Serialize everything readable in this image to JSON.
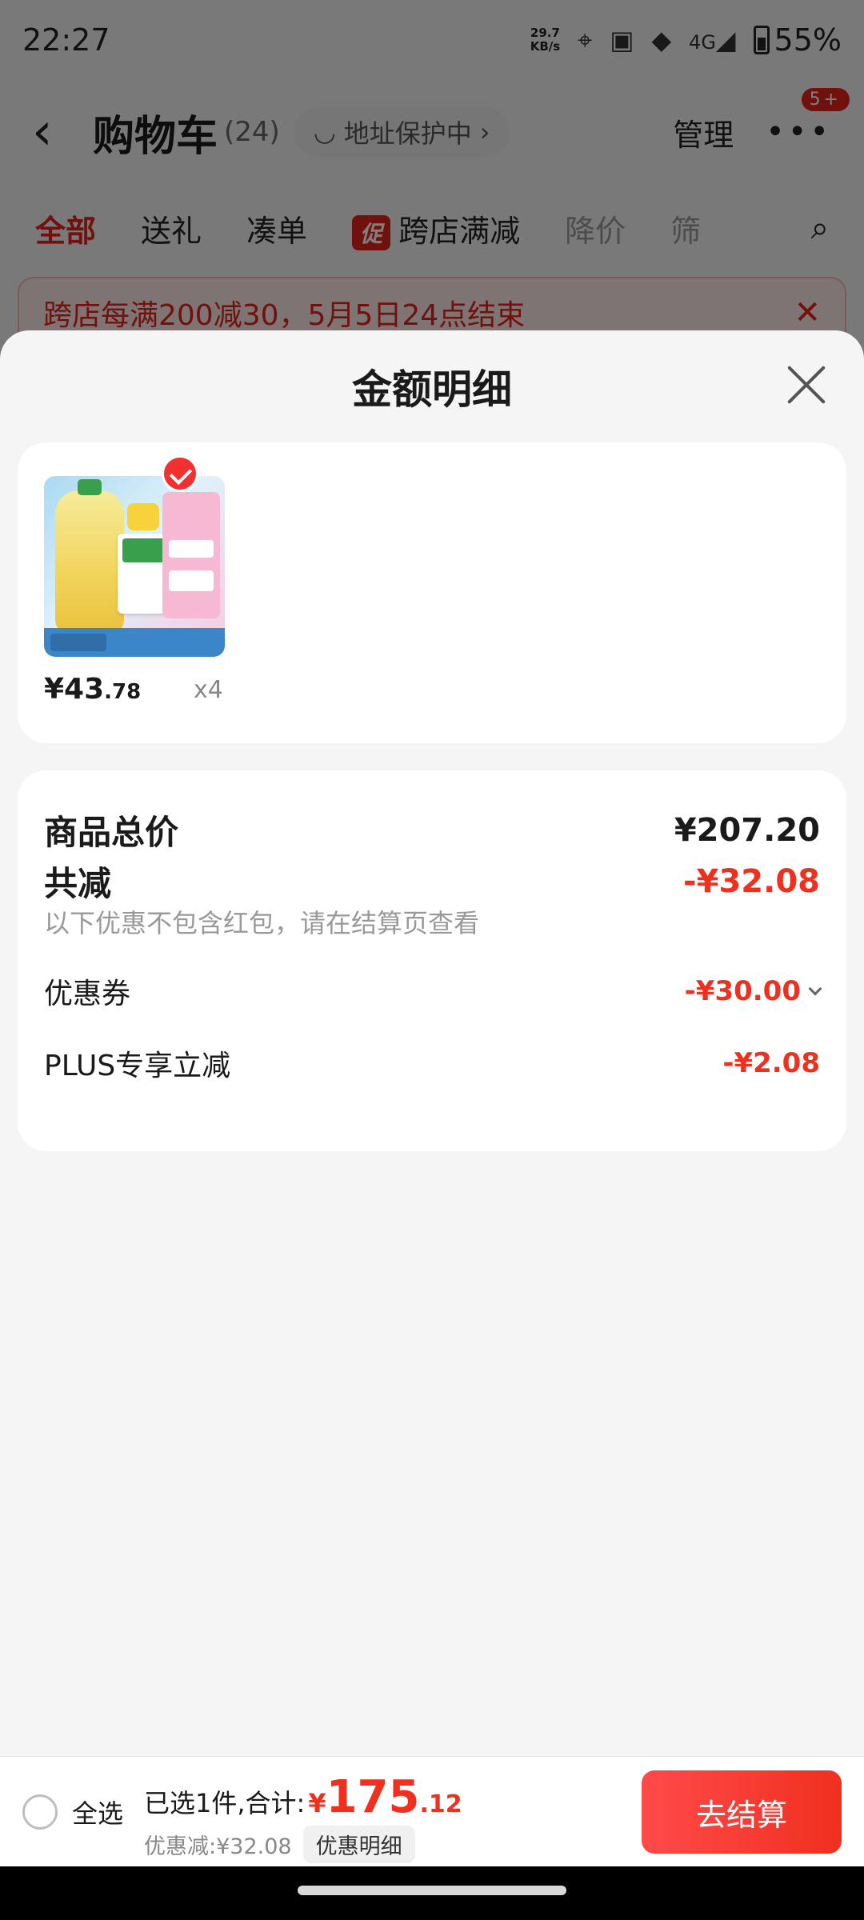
{
  "status": {
    "time": "22:27",
    "net_speed_value": "29.7",
    "net_speed_unit": "KB/s",
    "signal": "4G",
    "battery": "55%"
  },
  "cart": {
    "title": "购物车",
    "count": "(24)",
    "address_protect": "地址保护中",
    "manage": "管理",
    "more_badge": "5+"
  },
  "tabs": [
    {
      "label": "全部"
    },
    {
      "label": "送礼"
    },
    {
      "label": "凑单"
    },
    {
      "label": "跨店满减",
      "tag": "促"
    },
    {
      "label": "降价"
    },
    {
      "label": "筛"
    }
  ],
  "banner": {
    "text": "跨店每满200减30，5月5日24点结束"
  },
  "sheet": {
    "title": "金额明细",
    "product": {
      "price_int": "¥43",
      "price_dec": ".78",
      "quantity": "x4"
    },
    "summary": {
      "total_label": "商品总价",
      "total_value": "¥207.20",
      "reduce_label": "共减",
      "reduce_value": "-¥32.08",
      "note": "以下优惠不包含红包，请在结算页查看",
      "coupon_label": "优惠券",
      "coupon_value": "-¥30.00",
      "plus_label": "PLUS专享立减",
      "plus_value": "-¥2.08"
    }
  },
  "bottom": {
    "select_all": "全选",
    "selected_text": "已选1件,合计:",
    "total_yen": "¥",
    "total_int": "175",
    "total_dec": ".12",
    "discount_text": "优惠减:¥32.08",
    "discount_detail": "优惠明细",
    "checkout": "去结算"
  },
  "colors": {
    "accent_red": "#f0301f",
    "sheet_bg": "#f5f5f5"
  }
}
